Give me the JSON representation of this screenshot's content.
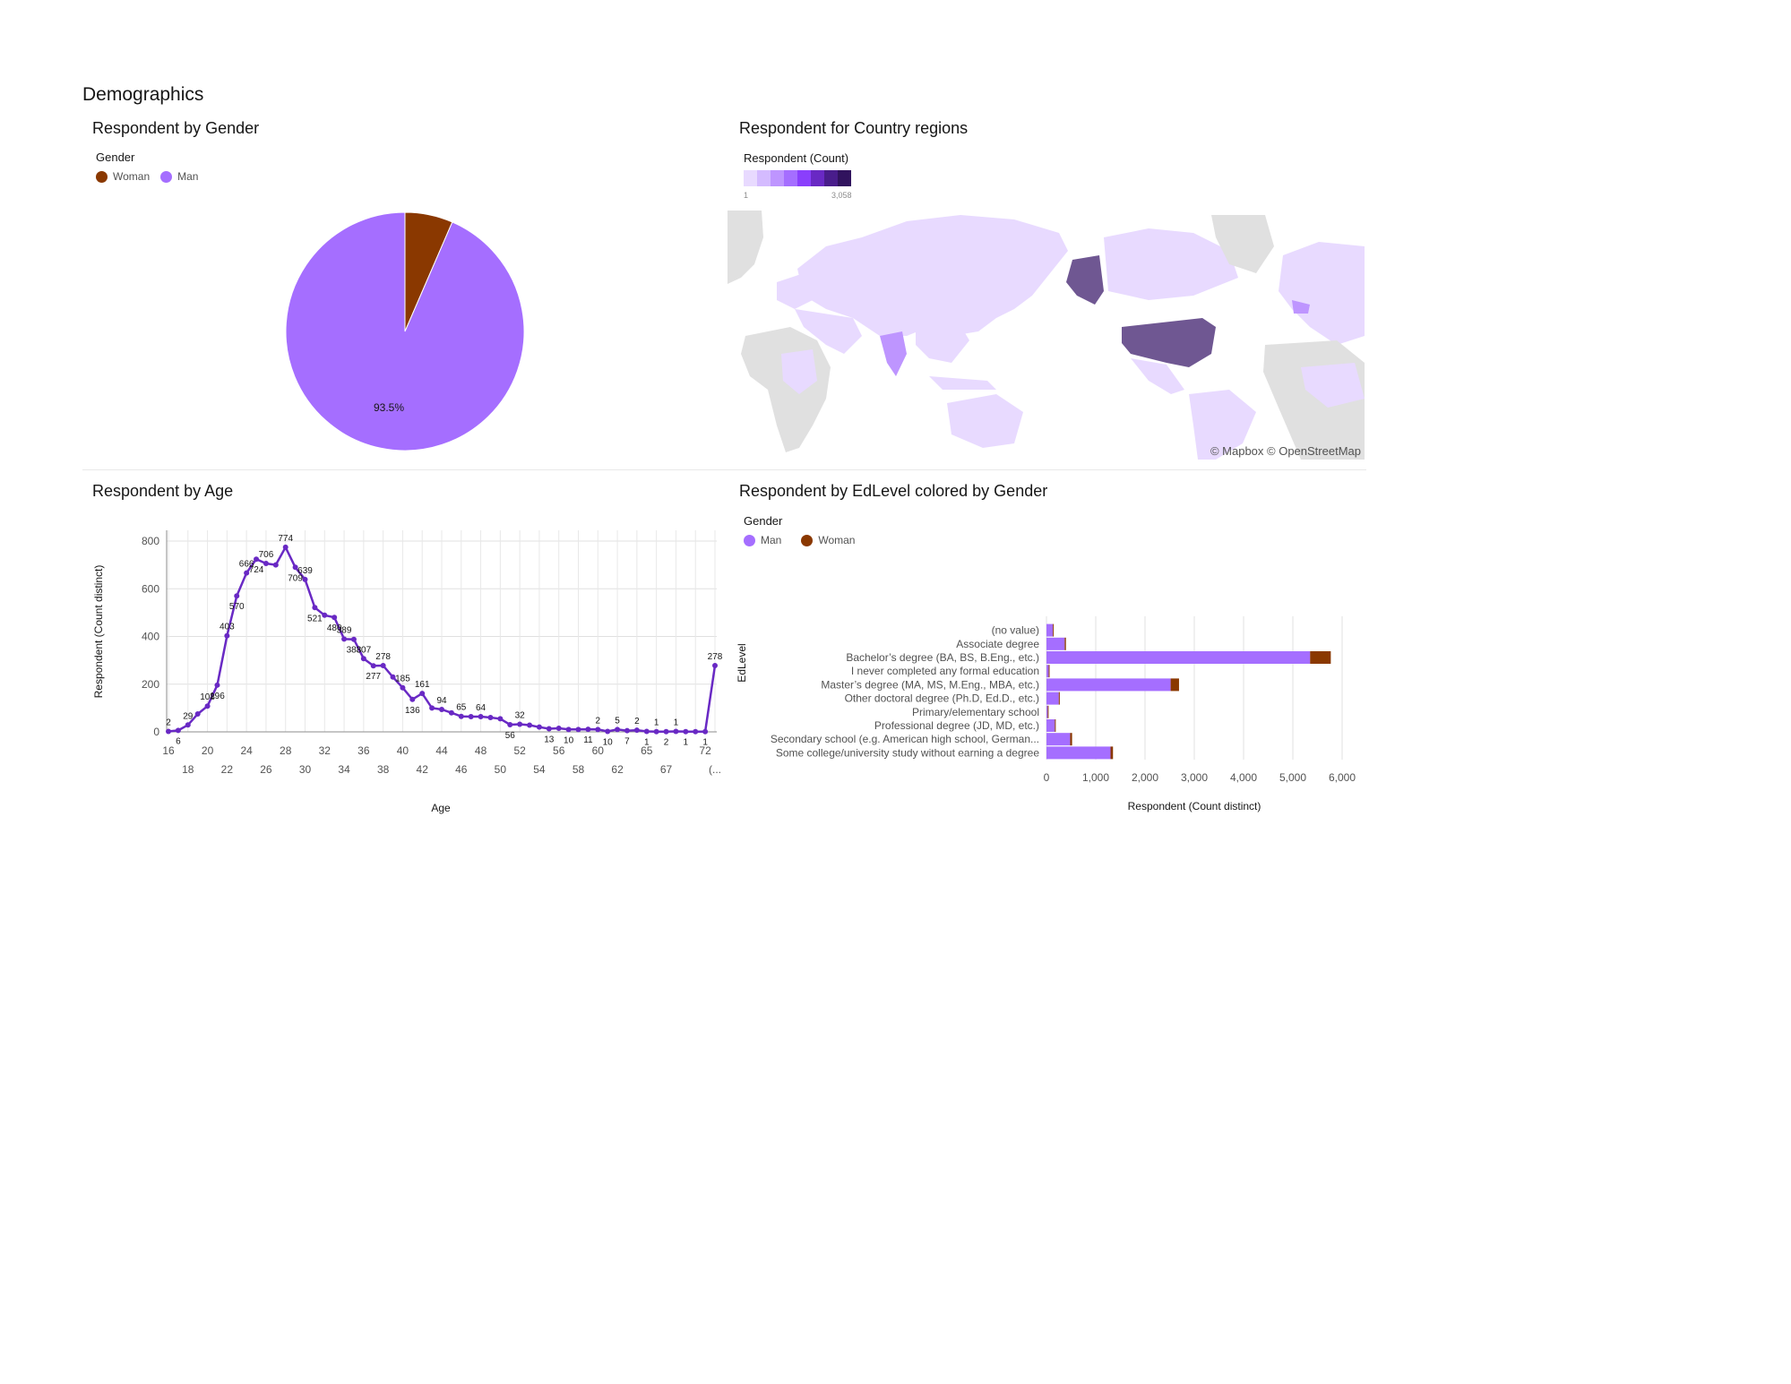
{
  "section": {
    "title": "Demographics"
  },
  "gender_panel": {
    "title": "Respondent by Gender",
    "legend_title": "Gender",
    "legend": [
      {
        "label": "Woman",
        "color": "#8a3800"
      },
      {
        "label": "Man",
        "color": "#a56eff"
      }
    ],
    "slice_label": "93.5%"
  },
  "country_panel": {
    "title": "Respondent for Country regions",
    "legend_title": "Respondent (Count)",
    "scale_min": "1",
    "scale_max": "3,058",
    "scale_colors": [
      "#e8daff",
      "#d4bbff",
      "#be95ff",
      "#a56eff",
      "#8a3ffc",
      "#6929c4",
      "#491d8b",
      "#31135e"
    ],
    "attribution": "© Mapbox © OpenStreetMap"
  },
  "age_panel": {
    "title": "Respondent by Age",
    "x_tick_labels_top": [
      "16",
      "20",
      "24",
      "28",
      "32",
      "36",
      "40",
      "44",
      "48",
      "52",
      "56",
      "60",
      "65",
      "72"
    ],
    "x_tick_labels_bottom": [
      "18",
      "22",
      "26",
      "30",
      "34",
      "38",
      "42",
      "46",
      "50",
      "54",
      "58",
      "62",
      "67",
      "(..."
    ],
    "y_tick_labels": [
      "800",
      "600",
      "400",
      "200",
      "0"
    ]
  },
  "edlevel_panel": {
    "title": "Respondent by EdLevel colored by Gender",
    "legend_title": "Gender",
    "legend": [
      {
        "label": "Man",
        "color": "#a56eff"
      },
      {
        "label": "Woman",
        "color": "#8a3800"
      }
    ],
    "x_tick_labels": [
      "0",
      "1,000",
      "2,000",
      "3,000",
      "4,000",
      "5,000",
      "6,000"
    ]
  },
  "chart_data": [
    {
      "type": "pie",
      "title": "Respondent by Gender",
      "categories": [
        "Woman",
        "Man"
      ],
      "values": [
        6.5,
        93.5
      ],
      "colors": [
        "#8a3800",
        "#a56eff"
      ],
      "data_labels": [
        "",
        "93.5%"
      ],
      "legend_placement": "top-left"
    },
    {
      "type": "line",
      "title": "Respondent by Age",
      "xlabel": "Age",
      "ylabel": "Respondent (Count distinct)",
      "ylim": [
        0,
        800
      ],
      "grid": true,
      "x": [
        "16",
        "17",
        "18",
        "19",
        "20",
        "21",
        "22",
        "23",
        "24",
        "25",
        "26",
        "27",
        "28",
        "29",
        "30",
        "31",
        "32",
        "33",
        "34",
        "35",
        "36",
        "37",
        "38",
        "39",
        "40",
        "41",
        "42",
        "43",
        "44",
        "45",
        "46",
        "47",
        "48",
        "49",
        "50",
        "51",
        "52",
        "53",
        "54",
        "55",
        "56",
        "57",
        "58",
        "59",
        "60",
        "61",
        "62",
        "63",
        "64",
        "65",
        "66",
        "67",
        "68",
        "69",
        "70",
        "72",
        "(..."
      ],
      "series": [
        {
          "color": "#6929c4",
          "values": [
            2,
            6,
            29,
            75,
            108,
            196,
            403,
            570,
            666,
            724,
            706,
            700,
            774,
            690,
            639,
            521,
            489,
            480,
            389,
            388,
            307,
            277,
            278,
            230,
            185,
            136,
            161,
            100,
            94,
            80,
            65,
            64,
            64,
            60,
            55,
            30,
            32,
            28,
            20,
            13,
            15,
            10,
            10,
            11,
            10,
            2,
            10,
            5,
            7,
            2,
            1,
            1,
            2,
            1,
            1,
            1,
            278
          ],
          "data_labels": [
            "2",
            "6",
            "29",
            "",
            "108",
            "196",
            "403",
            "570",
            "666",
            "724",
            "706",
            "",
            "774",
            "709",
            "639",
            "521",
            "",
            "480",
            "389",
            "388",
            "307",
            "277",
            "278",
            "",
            "185",
            "136",
            "161",
            "",
            "94",
            "",
            "65",
            "",
            "64",
            "",
            "",
            "56",
            "32",
            "",
            "",
            "13",
            "",
            "10",
            "",
            "11",
            "2",
            "10",
            "5",
            "7",
            "2",
            "1",
            "1",
            "2",
            "1",
            "1",
            "",
            "1",
            "278"
          ]
        }
      ]
    },
    {
      "type": "bar",
      "orientation": "horizontal",
      "stacked": true,
      "title": "Respondent by EdLevel colored by Gender",
      "xlabel": "Respondent (Count distinct)",
      "ylabel": "EdLevel",
      "xlim": [
        0,
        6000
      ],
      "grid": true,
      "legend_placement": "top-left",
      "categories": [
        "(no value)",
        "Associate degree",
        "Bachelor’s degree (BA, BS, B.Eng., etc.)",
        "I never completed any formal education",
        "Master’s degree (MA, MS, M.Eng., MBA, etc.)",
        "Other doctoral degree (Ph.D, Ed.D., etc.)",
        "Primary/elementary school",
        "Professional degree (JD, MD, etc.)",
        "Secondary school (e.g. American high school, German...",
        "Some college/university study without earning a degree"
      ],
      "series": [
        {
          "name": "Man",
          "color": "#a56eff",
          "values": [
            130,
            370,
            5350,
            45,
            2520,
            250,
            25,
            170,
            480,
            1300
          ]
        },
        {
          "name": "Woman",
          "color": "#8a3800",
          "values": [
            15,
            25,
            420,
            5,
            170,
            20,
            3,
            15,
            40,
            50
          ]
        }
      ]
    }
  ]
}
